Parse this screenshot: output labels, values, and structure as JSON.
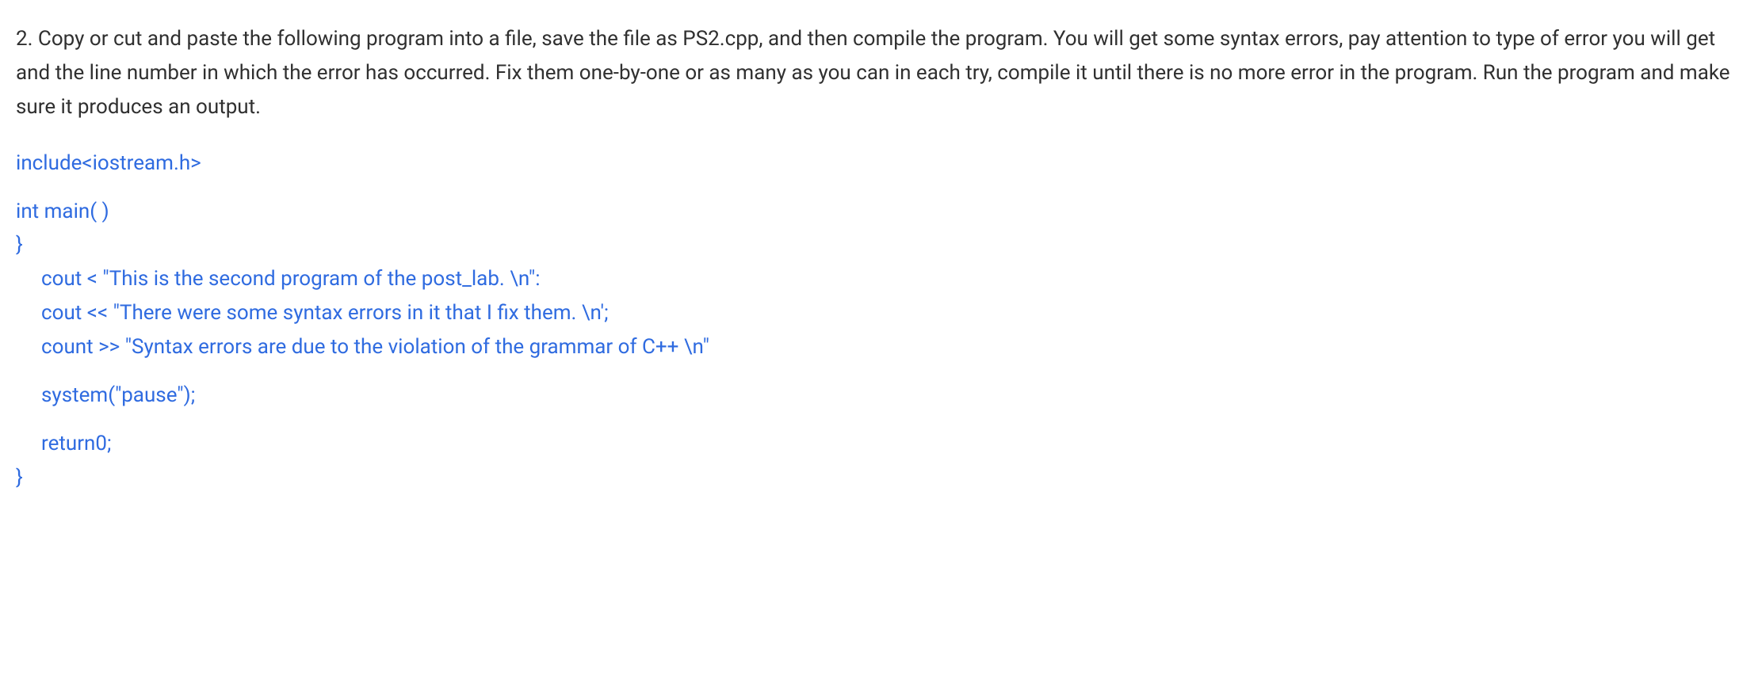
{
  "instruction": "2. Copy or cut and paste the following program into a file, save the file as PS2.cpp, and then compile the program.  You will get some syntax errors, pay attention to type of error you will get and the line number in which the error has occurred.  Fix them one-by-one or as many as you can in each try, compile it until there is no more error in the program.  Run the program and make sure it produces an output.",
  "code": {
    "line1": "include<iostream.h>",
    "line2": "int main( )",
    "line3": "}",
    "line4": "cout < \"This is the second program of the post_lab. \\n\":",
    "line5": "cout << \"There were some syntax errors in it that I fix them. \\n';",
    "line6": "count >> \"Syntax errors are due to the violation of the grammar of C++ \\n\"",
    "line7": "system(\"pause\");",
    "line8": "return0;",
    "line9": "}"
  }
}
